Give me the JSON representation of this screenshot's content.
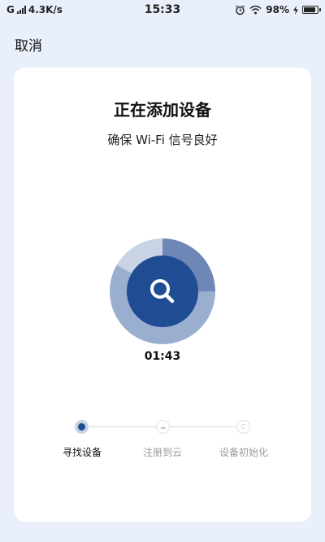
{
  "status_bar": {
    "network_type": "G",
    "speed": "4.3K/s",
    "time": "15:33",
    "battery": "98%"
  },
  "header": {
    "cancel_label": "取消"
  },
  "card": {
    "title": "正在添加设备",
    "subtitle": "确保 Wi-Fi 信号良好",
    "timer": "01:43",
    "steps": [
      {
        "label": "寻找设备",
        "state": "active"
      },
      {
        "label": "注册到云",
        "state": "pending"
      },
      {
        "label": "设备初始化",
        "state": "pending"
      }
    ]
  },
  "colors": {
    "accent": "#1f4c93",
    "background": "#e9f0fb",
    "card": "#ffffff"
  }
}
